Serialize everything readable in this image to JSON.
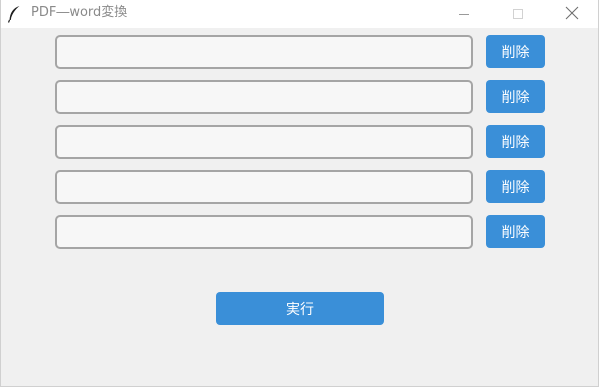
{
  "window": {
    "title": "PDF―word変換",
    "app_icon": "feather-icon",
    "controls": [
      "minimize-icon",
      "maximize-icon",
      "close-icon"
    ]
  },
  "rows": [
    {
      "path_value": "",
      "delete_label": "削除"
    },
    {
      "path_value": "",
      "delete_label": "削除"
    },
    {
      "path_value": "",
      "delete_label": "削除"
    },
    {
      "path_value": "",
      "delete_label": "削除"
    },
    {
      "path_value": "",
      "delete_label": "削除"
    }
  ],
  "run_button": {
    "label": "実行"
  },
  "colors": {
    "accent": "#3a8fd8",
    "background": "#f0f0f0",
    "input_border": "#a5a5a5",
    "title_text": "#8a8a8a"
  }
}
